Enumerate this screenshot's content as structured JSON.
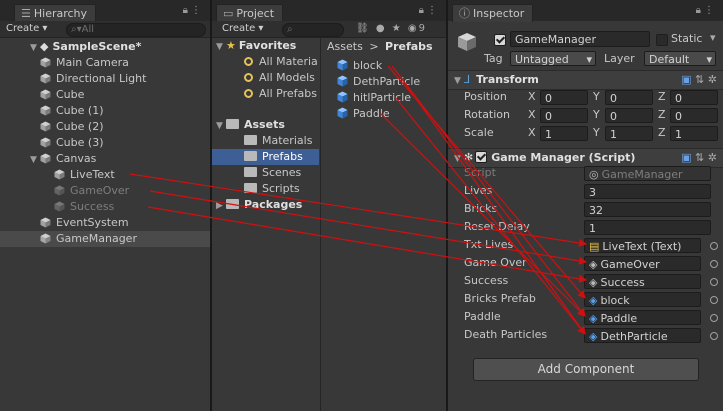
{
  "hierarchy": {
    "tab": "Hierarchy",
    "create": "Create",
    "search_placeholder": "All",
    "scene": "SampleScene*",
    "items": [
      "Main Camera",
      "Directional Light",
      "Cube",
      "Cube (1)",
      "Cube (2)",
      "Cube (3)",
      "Canvas",
      "LiveText",
      "GameOver",
      "Success",
      "EventSystem",
      "GameManager"
    ]
  },
  "project": {
    "tab": "Project",
    "create": "Create",
    "favorites": "Favorites",
    "favorite_items": [
      "All Materia",
      "All Models",
      "All Prefabs"
    ],
    "assets": "Assets",
    "asset_folders": [
      "Materials",
      "Prefabs",
      "Scenes",
      "Scripts"
    ],
    "packages": "Packages",
    "breadcrumb": {
      "root": "Assets",
      "sep": ">",
      "current": "Prefabs"
    },
    "prefabs": [
      "block",
      "DethParticle",
      "hitlParticle",
      "Paddle"
    ],
    "hidden_count": "9"
  },
  "inspector": {
    "tab": "Inspector",
    "name": "GameManager",
    "static_label": "Static",
    "tag_label": "Tag",
    "tag_value": "Untagged",
    "layer_label": "Layer",
    "layer_value": "Default",
    "transform": {
      "title": "Transform",
      "rows": [
        {
          "label": "Position",
          "x": "0",
          "y": "0",
          "z": "0"
        },
        {
          "label": "Rotation",
          "x": "0",
          "y": "0",
          "z": "0"
        },
        {
          "label": "Scale",
          "x": "1",
          "y": "1",
          "z": "1"
        }
      ],
      "axis_x": "X",
      "axis_y": "Y",
      "axis_z": "Z"
    },
    "script_component": {
      "title": "Game Manager (Script)",
      "fields": [
        {
          "label": "Script",
          "value": "GameManager"
        },
        {
          "label": "Lives",
          "value": "3"
        },
        {
          "label": "Bricks",
          "value": "32"
        },
        {
          "label": "Reset Delay",
          "value": "1"
        },
        {
          "label": "Txt Lives",
          "value": "LiveText (Text)"
        },
        {
          "label": "Game Over",
          "value": "GameOver"
        },
        {
          "label": "Success",
          "value": "Success"
        },
        {
          "label": "Bricks Prefab",
          "value": "block"
        },
        {
          "label": "Paddle",
          "value": "Paddle"
        },
        {
          "label": "Death Particles",
          "value": "DethParticle"
        }
      ]
    },
    "add_component": "Add Component"
  },
  "colors": {
    "annotation_arrow": "#d01010",
    "selection": "#3e5f96"
  }
}
